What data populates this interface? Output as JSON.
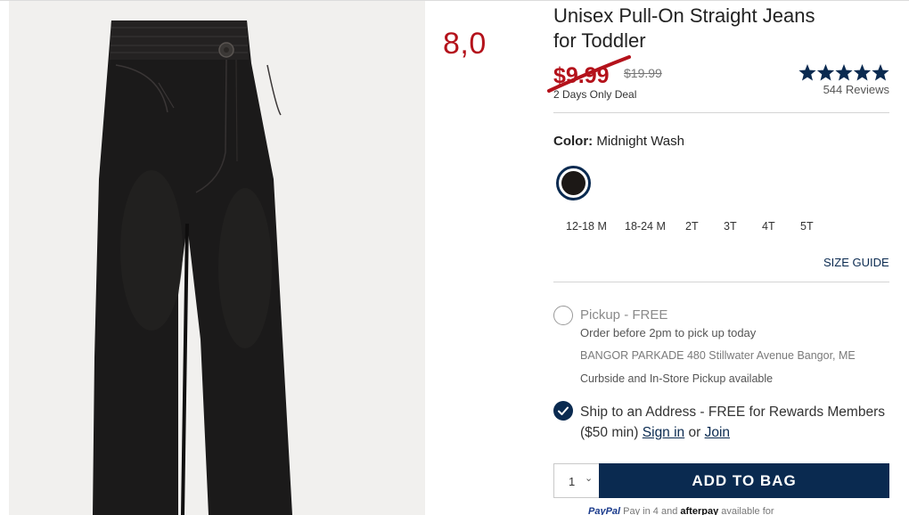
{
  "product": {
    "title_line1": "Unisex Pull-On Straight Jeans",
    "title_line2": "for Toddler",
    "sale_price": "$9.99",
    "original_price": "$19.99",
    "deal_note": "2 Days Only Deal",
    "rating": 5,
    "reviews_text": "544 Reviews",
    "promo_overlay": "8,0"
  },
  "color": {
    "label": "Color:",
    "value": "Midnight Wash",
    "swatch_color": "#1c1816"
  },
  "sizes": [
    "12-18 M",
    "18-24 M",
    "2T",
    "3T",
    "4T",
    "5T"
  ],
  "size_guide": "SIZE GUIDE",
  "fulfillment": {
    "pickup_title": "Pickup - FREE",
    "pickup_note": "Order before 2pm to pick up today",
    "store_name": "BANGOR PARKADE",
    "store_address": "480 Stillwater Avenue",
    "store_city": "Bangor, ME",
    "curbside_note": "Curbside and In-Store Pickup available",
    "ship_text": "Ship to an Address - FREE for Rewards Members ($50 min)",
    "sign_in": "Sign in",
    "or_word": "or",
    "join": "Join"
  },
  "cart": {
    "quantity": "1",
    "add_label": "ADD TO BAG"
  },
  "payment": {
    "paypal_label": "PayPal",
    "paypal_text": "Pay in 4",
    "and_word": "and",
    "afterpay_label": "afterpay",
    "available_text": "available for"
  },
  "colors": {
    "brand_navy": "#0a2a50",
    "sale_red": "#b4121b"
  }
}
